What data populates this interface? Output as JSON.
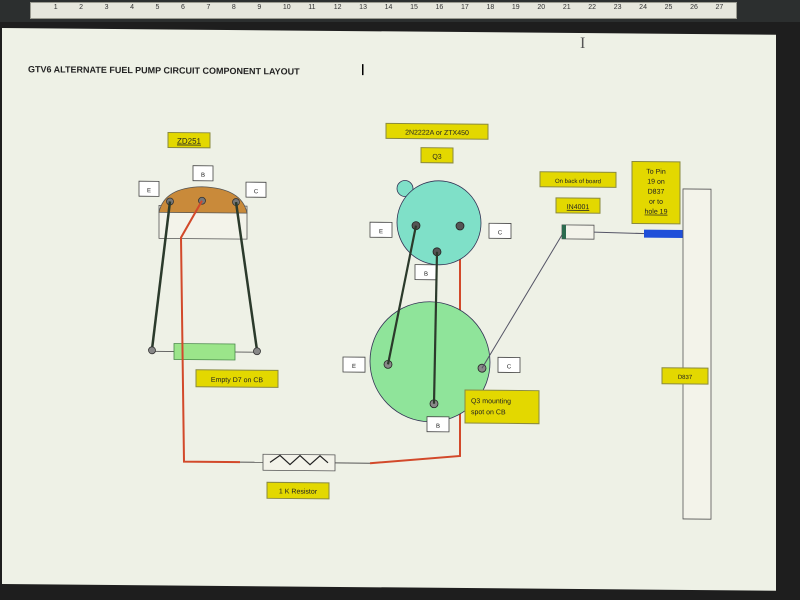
{
  "ruler": {
    "numbers": [
      "1",
      "2",
      "3",
      "4",
      "5",
      "6",
      "7",
      "8",
      "9",
      "10",
      "11",
      "12",
      "13",
      "14",
      "15",
      "16",
      "17",
      "18",
      "19",
      "20",
      "21",
      "22",
      "23",
      "24",
      "25",
      "26",
      "27"
    ]
  },
  "diagram": {
    "title": "GTV6 ALTERNATE FUEL PUMP CIRCUIT COMPONENT LAYOUT",
    "zd": {
      "part": "ZD251",
      "pins": {
        "e": "E",
        "b": "B",
        "c": "C"
      }
    },
    "q3": {
      "part": "2N2222A or ZTX450",
      "name": "Q3",
      "pins": {
        "e": "E",
        "b": "B",
        "c": "C"
      }
    },
    "pad": {
      "pins": {
        "e": "E",
        "b": "B",
        "c": "C"
      },
      "note": [
        "Q3 mounting",
        "spot on CB"
      ]
    },
    "diode": {
      "label": "IN4001",
      "note": "On back of board"
    },
    "pin_note": [
      "To Pin",
      "19 on",
      "D837",
      "or to",
      "hole 19"
    ],
    "connector": "D837",
    "empty_slot": "Empty D7 on CB",
    "resistor": "1 K Resistor",
    "colors": {
      "label_fill": "#e3d800",
      "zd_body": "#c98a3a",
      "q3_body": "#7fe0c8",
      "pad_body": "#8fe49a",
      "wire_red": "#d2492a",
      "wire_dark": "#2b3a2b",
      "wire_blue": "#1f4fd9",
      "slot_green": "#9be58a"
    }
  }
}
